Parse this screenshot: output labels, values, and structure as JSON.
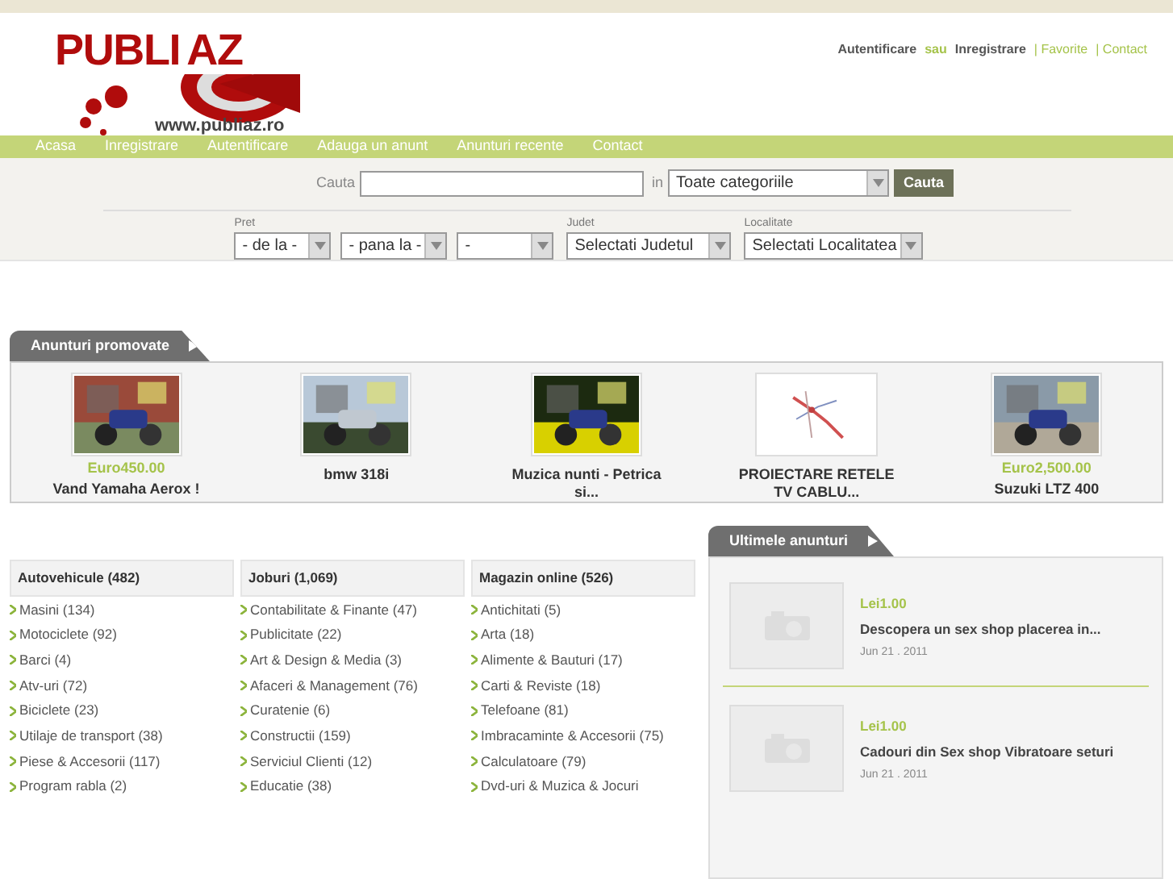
{
  "logo": {
    "name_left": "PUBLI",
    "name_right": "AZ",
    "url": "www.publiaz.ro"
  },
  "top_links": [
    {
      "label": "Autentificare",
      "kind": "link"
    },
    {
      "label": "sau",
      "kind": "text"
    },
    {
      "label": "Inregistrare",
      "kind": "link"
    },
    {
      "label": "| Favorite",
      "kind": "accent"
    },
    {
      "label": "| Contact",
      "kind": "accent"
    }
  ],
  "nav": [
    "Acasa",
    "Inregistrare",
    "Autentificare",
    "Adauga un anunt",
    "Anunturi recente",
    "Contact"
  ],
  "search": {
    "label": "Cauta",
    "in_label": "in",
    "category": "Toate categoriile",
    "button": "Cauta"
  },
  "filters": [
    {
      "label": "Pret",
      "selects": [
        {
          "value": "- de la -"
        },
        {
          "value": "- pana la -"
        },
        {
          "value": "-"
        }
      ]
    },
    {
      "label": "Judet",
      "selects": [
        {
          "value": "Selectati Judetul"
        }
      ]
    },
    {
      "label": "Localitate",
      "selects": [
        {
          "value": "Selectati Localitatea"
        }
      ]
    }
  ],
  "promoted": {
    "title": "Anunturi promovate",
    "items": [
      {
        "price": "Euro450.00",
        "title": "Vand Yamaha Aerox !",
        "kind": "picture"
      },
      {
        "title": "bmw 318i",
        "kind": "picture"
      },
      {
        "title": "Muzica nunti - Petrica si...",
        "kind": "picture"
      },
      {
        "title": "PROIECTARE RETELE TV CABLU...",
        "kind": "map"
      },
      {
        "price": "Euro2,500.00",
        "title": "Suzuki LTZ 400",
        "kind": "picture"
      }
    ]
  },
  "categories": [
    {
      "title": "Autovehicule (482)",
      "items": [
        "Masini (134)",
        "Motociclete (92)",
        "Barci (4)",
        "Atv-uri (72)",
        "Biciclete (23)",
        "Utilaje de transport (38)",
        "Piese & Accesorii (117)",
        "Program rabla (2)"
      ]
    },
    {
      "title": "Joburi (1,069)",
      "items": [
        "Contabilitate & Finante (47)",
        "Publicitate (22)",
        "Art & Design & Media (3)",
        "Afaceri & Management (76)",
        "Curatenie (6)",
        "Constructii (159)",
        "Serviciul Clienti (12)",
        "Educatie (38)"
      ]
    },
    {
      "title": "Magazin online (526)",
      "items": [
        "Antichitati (5)",
        "Arta (18)",
        "Alimente & Bauturi (17)",
        "Carti & Reviste (18)",
        "Telefoane (81)",
        "Imbracaminte & Accesorii (75)",
        "Calculatoare (79)",
        "Dvd-uri & Muzica & Jocuri"
      ]
    }
  ],
  "latest": {
    "title": "Ultimele anunturi",
    "items": [
      {
        "price": "Lei1.00",
        "title": "Descopera un sex shop placerea in...",
        "date": "Jun 21 . 2011"
      },
      {
        "price": "Lei1.00",
        "title": "Cadouri din Sex shop Vibratoare seturi",
        "date": "Jun 21 . 2011"
      }
    ]
  }
}
